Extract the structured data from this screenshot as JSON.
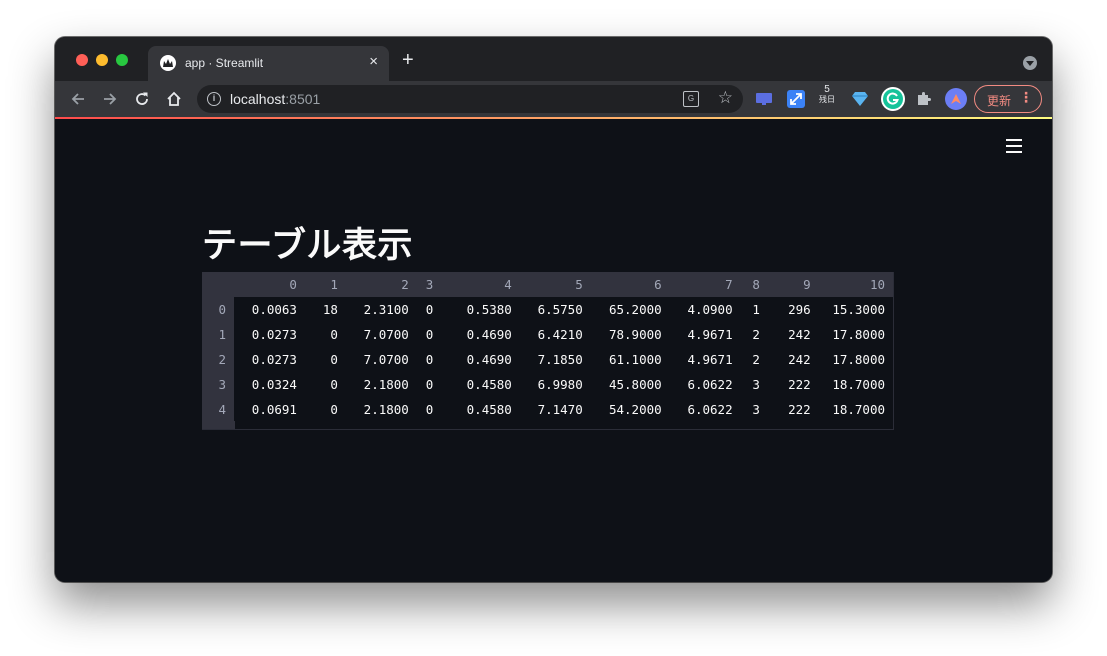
{
  "browser": {
    "tab_title": "app · Streamlit",
    "new_tab_label": "+",
    "close_label": "×",
    "url_host": "localhost",
    "url_port": ":8501",
    "extension_badge_number": "5",
    "extension_badge_text": "残日",
    "update_label": "更新",
    "accent_update": "#f28b82"
  },
  "page": {
    "title": "テーブル表示",
    "menu_icon": "hamburger-icon"
  },
  "table": {
    "columns": [
      "",
      "0",
      "1",
      "2",
      "3",
      "4",
      "5",
      "6",
      "7",
      "8",
      "9",
      "10"
    ],
    "rows": [
      [
        "0",
        "0.0063",
        "18",
        "2.3100",
        "0",
        "0.5380",
        "6.5750",
        "65.2000",
        "4.0900",
        "1",
        "296",
        "15.3000"
      ],
      [
        "1",
        "0.0273",
        "0",
        "7.0700",
        "0",
        "0.4690",
        "6.4210",
        "78.9000",
        "4.9671",
        "2",
        "242",
        "17.8000"
      ],
      [
        "2",
        "0.0273",
        "0",
        "7.0700",
        "0",
        "0.4690",
        "7.1850",
        "61.1000",
        "4.9671",
        "2",
        "242",
        "17.8000"
      ],
      [
        "3",
        "0.0324",
        "0",
        "2.1800",
        "0",
        "0.4580",
        "6.9980",
        "45.8000",
        "6.0622",
        "3",
        "222",
        "18.7000"
      ],
      [
        "4",
        "0.0691",
        "0",
        "2.1800",
        "0",
        "0.4580",
        "7.1470",
        "54.2000",
        "6.0622",
        "3",
        "222",
        "18.7000"
      ]
    ]
  }
}
